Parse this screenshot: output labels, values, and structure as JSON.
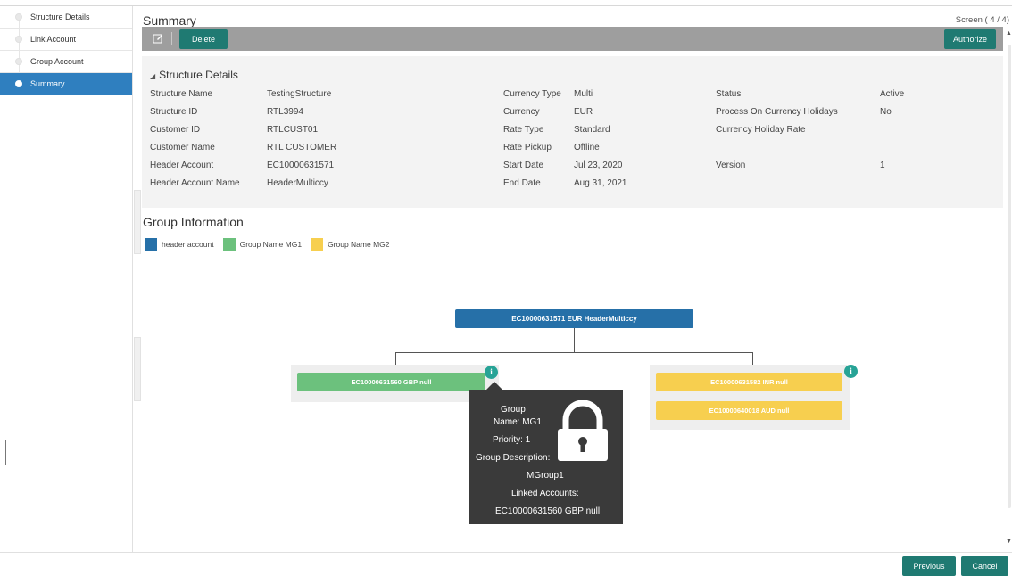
{
  "sidebar": {
    "steps": [
      {
        "label": "Structure Details"
      },
      {
        "label": "Link Account"
      },
      {
        "label": "Group Account"
      },
      {
        "label": "Summary"
      }
    ],
    "active_index": 3
  },
  "header": {
    "title": "Summary",
    "screen_indicator": "Screen ( 4 / 4)"
  },
  "toolbar": {
    "edit_icon": "edit-icon",
    "delete_label": "Delete",
    "authorize_label": "Authorize"
  },
  "structure_details": {
    "title": "Structure Details",
    "fields": {
      "structure_name": {
        "label": "Structure Name",
        "value": "TestingStructure"
      },
      "structure_id": {
        "label": "Structure ID",
        "value": "RTL3994"
      },
      "customer_id": {
        "label": "Customer ID",
        "value": "RTLCUST01"
      },
      "customer_name": {
        "label": "Customer Name",
        "value": "RTL CUSTOMER"
      },
      "header_account": {
        "label": "Header Account",
        "value": "EC10000631571"
      },
      "header_account_name": {
        "label": "Header Account Name",
        "value": "HeaderMulticcy"
      },
      "currency_type": {
        "label": "Currency Type",
        "value": "Multi"
      },
      "currency": {
        "label": "Currency",
        "value": "EUR"
      },
      "rate_type": {
        "label": "Rate Type",
        "value": "Standard"
      },
      "rate_pickup": {
        "label": "Rate Pickup",
        "value": "Offline"
      },
      "start_date": {
        "label": "Start Date",
        "value": "Jul 23, 2020"
      },
      "end_date": {
        "label": "End Date",
        "value": "Aug 31, 2021"
      },
      "status": {
        "label": "Status",
        "value": "Active"
      },
      "process_on_currency_holidays": {
        "label": "Process On Currency Holidays",
        "value": "No"
      },
      "currency_holiday_rate": {
        "label": "Currency Holiday Rate",
        "value": ""
      },
      "version": {
        "label": "Version",
        "value": "1"
      }
    }
  },
  "group_information": {
    "title": "Group Information",
    "legend": [
      {
        "label": "header account",
        "color": "#2670a8"
      },
      {
        "label": "Group Name MG1",
        "color": "#6cc17d"
      },
      {
        "label": "Group Name MG2",
        "color": "#f7cf4f"
      }
    ],
    "root_node": "EC10000631571 EUR HeaderMulticcy",
    "groups": [
      {
        "nodes": [
          "EC10000631560 GBP null"
        ],
        "color": "#6cc17d"
      },
      {
        "nodes": [
          "EC10000631582 INR null",
          "EC10000640018 AUD null"
        ],
        "color": "#f7cf4f"
      }
    ],
    "info_badge": "i",
    "tooltip": {
      "lines": [
        "Group",
        "Name: MG1",
        "Priority: 1",
        "Group Description:",
        "MGroup1",
        "Linked Accounts:",
        "EC10000631560 GBP null"
      ],
      "icon": "lock-icon"
    }
  },
  "footer": {
    "previous_label": "Previous",
    "cancel_label": "Cancel"
  },
  "colors": {
    "accent": "#1f7a72",
    "sidebar_active": "#2f7fbf",
    "toolbar": "#9e9e9e"
  }
}
